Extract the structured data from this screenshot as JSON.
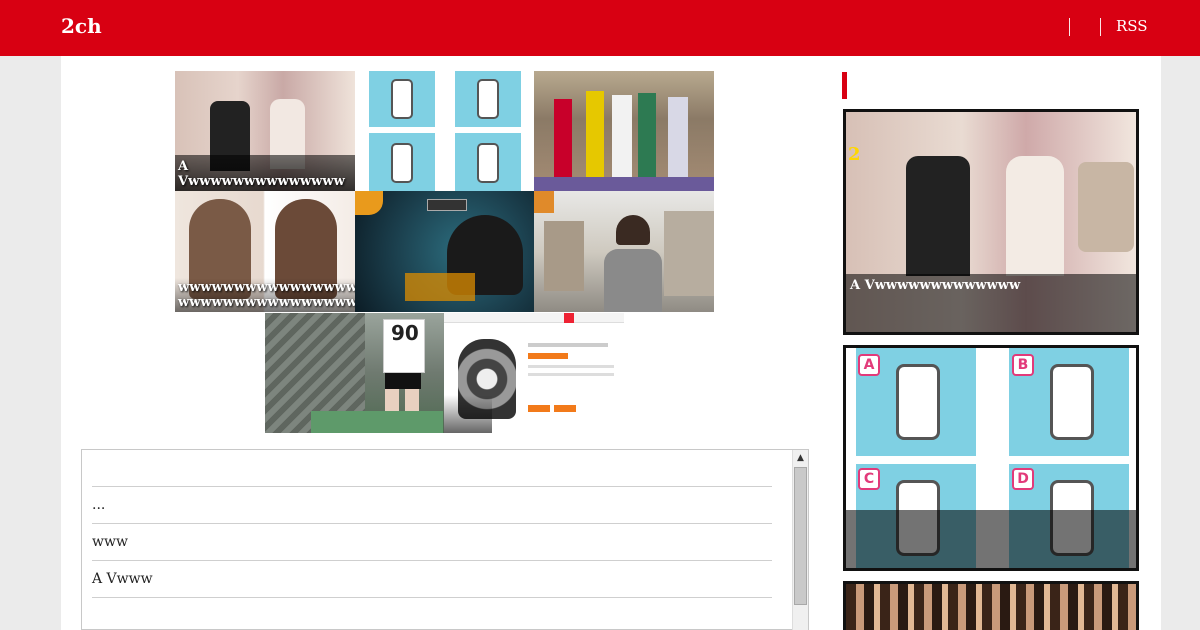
{
  "header": {
    "site_title": "2ch",
    "rss_label": "RSS"
  },
  "thumbnails": [
    {
      "id": "av-talk",
      "caption": "A Vwwwwwwwwwwwwww"
    },
    {
      "id": "phone-grip",
      "caption": ""
    },
    {
      "id": "costume-group",
      "caption": ""
    },
    {
      "id": "hair-compare",
      "caption": "wwwwwwwwwwwwwwwwwwww\nwwwwwwwwwwwwwwww"
    },
    {
      "id": "keyaki46",
      "caption": ""
    },
    {
      "id": "street-woman",
      "caption": ""
    },
    {
      "id": "baseball-90",
      "caption": ""
    },
    {
      "id": "hoodie-listing",
      "caption": ""
    }
  ],
  "comments": [
    {
      "text": ""
    },
    {
      "text": "..."
    },
    {
      "text": "www"
    },
    {
      "text": "A Vwww"
    }
  ],
  "sidebar": {
    "cards": [
      {
        "id": "side-av-talk",
        "rank": "2",
        "caption": "A Vwwwwwwwwwwwww"
      },
      {
        "id": "side-phone-grip",
        "rank": "",
        "caption": ""
      },
      {
        "id": "side-crowd",
        "rank": "",
        "caption": ""
      }
    ]
  },
  "colors": {
    "brand": "#d80012",
    "background": "#ebebeb"
  }
}
